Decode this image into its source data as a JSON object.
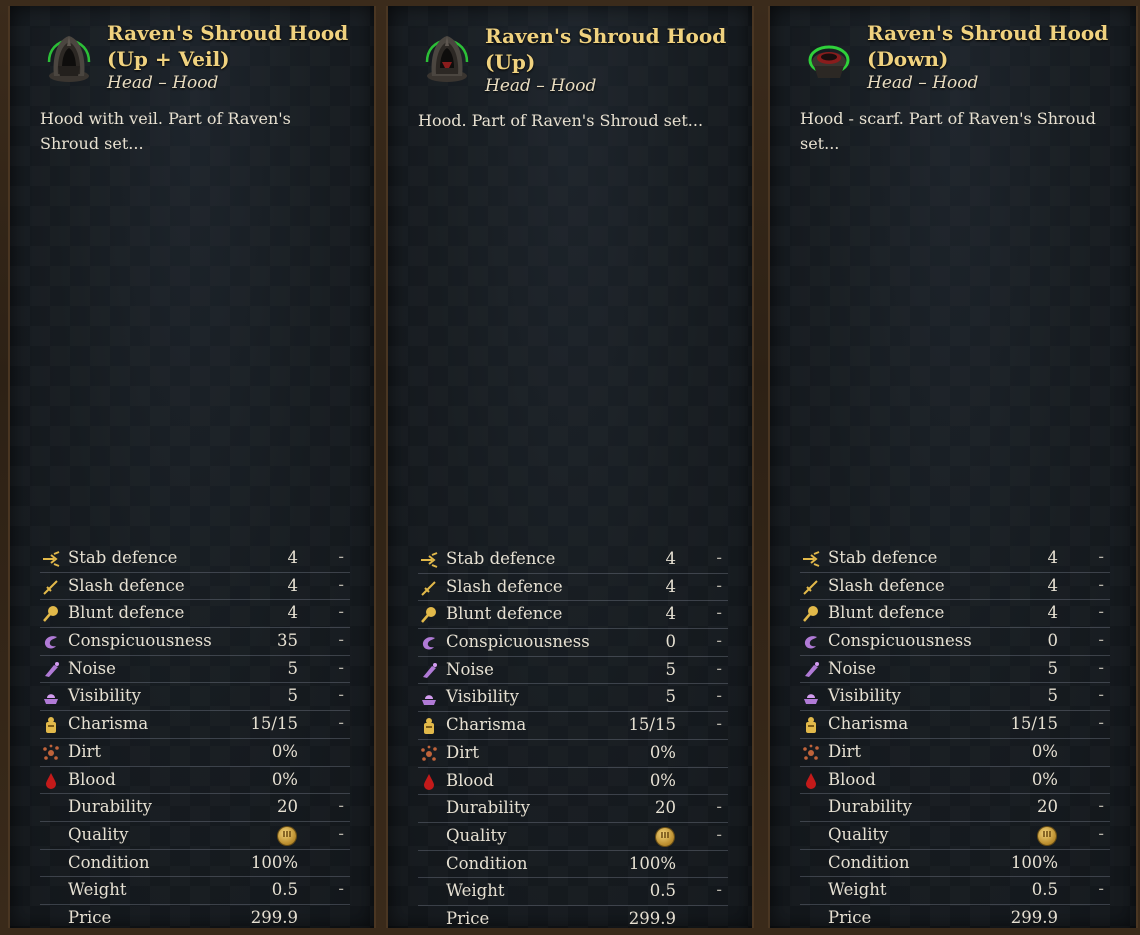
{
  "stat_labels": {
    "stab": "Stab defence",
    "slash": "Slash defence",
    "blunt": "Blunt defence",
    "consp": "Conspicuousness",
    "noise": "Noise",
    "visibility": "Visibility",
    "charisma": "Charisma",
    "dirt": "Dirt",
    "blood": "Blood",
    "durability": "Durability",
    "quality": "Quality",
    "condition": "Condition",
    "weight": "Weight",
    "price": "Price"
  },
  "dash": "-",
  "colors": {
    "title": "#f0d27f",
    "text": "#e6e0d2",
    "equipped_ring": "#2fd13a"
  },
  "panels": [
    {
      "title_line1": "Raven's Shroud Hood",
      "title_line2": "(Up + Veil)",
      "subtitle": "Head – Hood",
      "description": "Hood with veil. Part of Raven's Shroud set...",
      "icon": "hood-up-veil-icon",
      "stats": {
        "stab": "4",
        "slash": "4",
        "blunt": "4",
        "consp": "35",
        "noise": "5",
        "visibility": "5",
        "charisma": "15/15",
        "dirt": "0%",
        "blood": "0%",
        "durability": "20",
        "quality": 3,
        "condition": "100%",
        "weight": "0.5",
        "price": "299.9"
      }
    },
    {
      "title_line1": "Raven's Shroud Hood",
      "title_line2": "(Up)",
      "subtitle": "Head – Hood",
      "description": "Hood. Part of Raven's Shroud set...",
      "icon": "hood-up-icon",
      "stats": {
        "stab": "4",
        "slash": "4",
        "blunt": "4",
        "consp": "0",
        "noise": "5",
        "visibility": "5",
        "charisma": "15/15",
        "dirt": "0%",
        "blood": "0%",
        "durability": "20",
        "quality": 3,
        "condition": "100%",
        "weight": "0.5",
        "price": "299.9"
      }
    },
    {
      "title_line1": "Raven's Shroud Hood",
      "title_line2": "(Down)",
      "subtitle": "Head – Hood",
      "description": "Hood - scarf. Part of Raven's Shroud set...",
      "icon": "hood-down-icon",
      "stats": {
        "stab": "4",
        "slash": "4",
        "blunt": "4",
        "consp": "0",
        "noise": "5",
        "visibility": "5",
        "charisma": "15/15",
        "dirt": "0%",
        "blood": "0%",
        "durability": "20",
        "quality": 3,
        "condition": "100%",
        "weight": "0.5",
        "price": "299.9"
      }
    }
  ]
}
